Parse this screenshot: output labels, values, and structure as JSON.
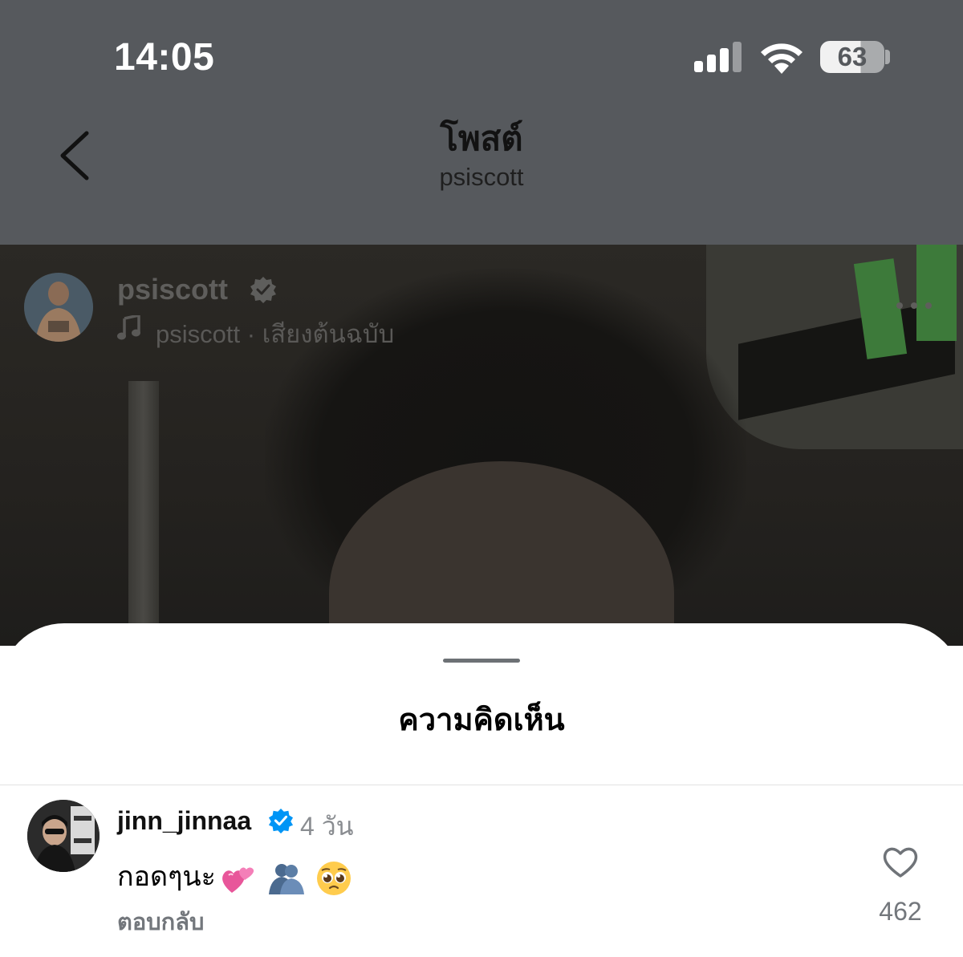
{
  "status_bar": {
    "time": "14:05",
    "battery": "63"
  },
  "nav": {
    "title": "โพสต์",
    "subtitle": "psiscott"
  },
  "post": {
    "username": "psiscott",
    "audio": "psiscott · เสียงต้นฉบับ"
  },
  "comments_sheet": {
    "title": "ความคิดเห็น",
    "comments": [
      {
        "username": "jinn_jinnaa",
        "time": "4 วัน",
        "text": "กอดๆนะ",
        "reply_label": "ตอบกลับ",
        "likes": "462"
      }
    ]
  },
  "colors": {
    "verified": "#0095f6",
    "overlay": "#56595d"
  },
  "icons": [
    "back-icon",
    "signal-icon",
    "wifi-icon",
    "battery-icon",
    "verified-icon",
    "music-icon",
    "more-icon",
    "heart-icon"
  ]
}
